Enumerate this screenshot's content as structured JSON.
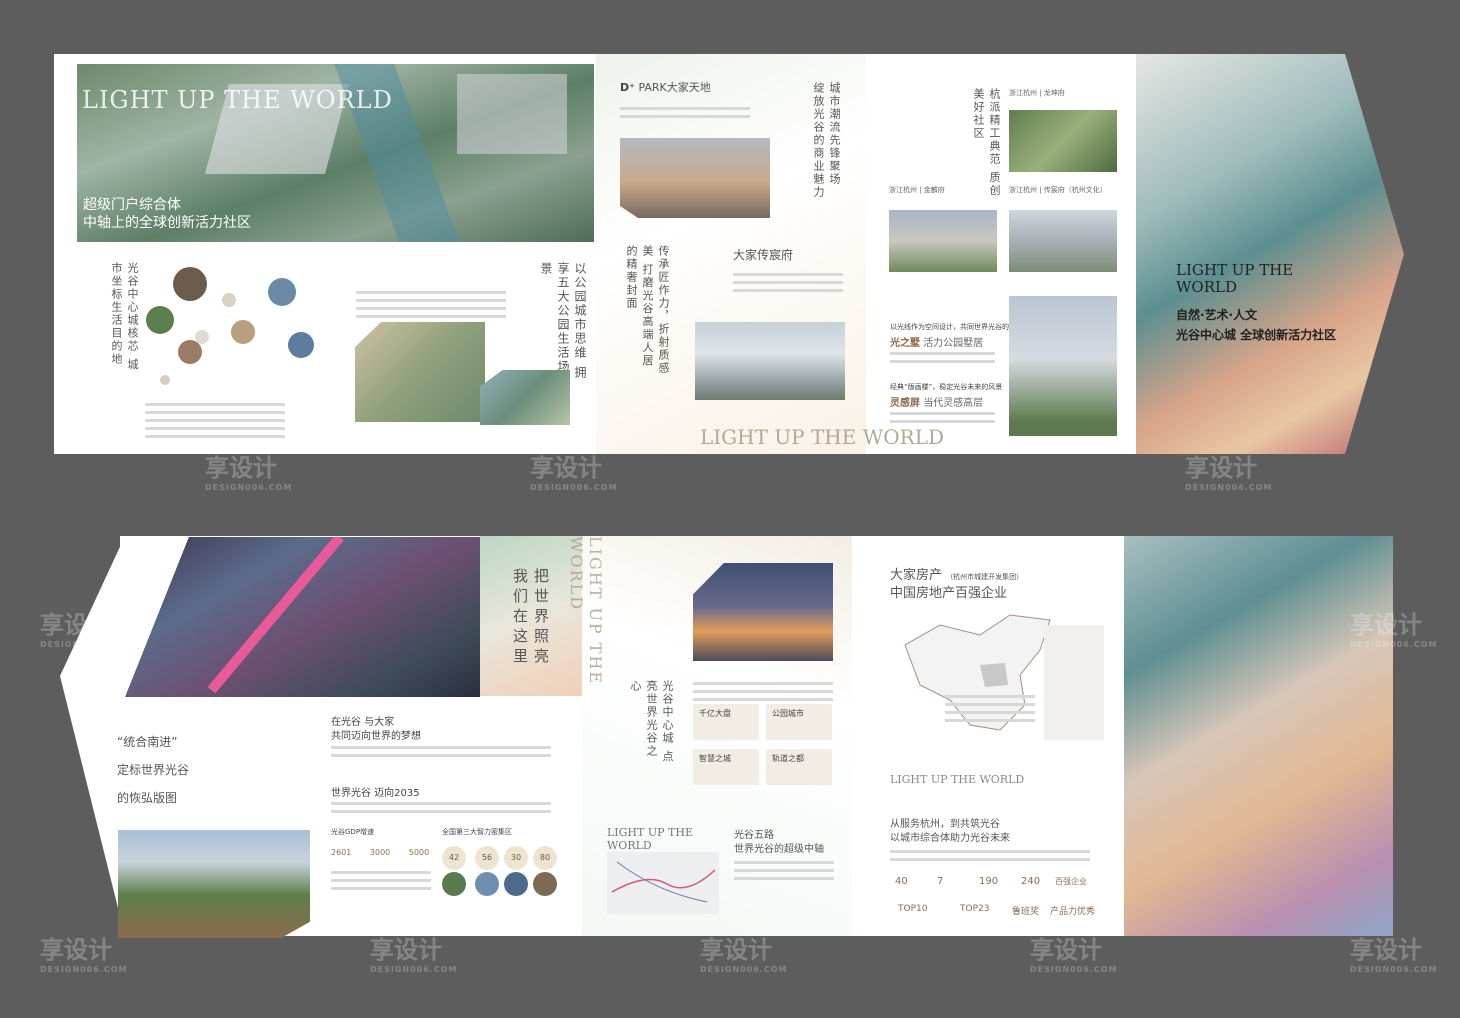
{
  "top": {
    "p1": {
      "logo": "LIGHT UP THE WORLD",
      "headline1": "超级门户综合体",
      "headline2": "中轴上的全球创新活力社区",
      "vertical_caption": "光谷中心城核芯 城市坐标生活目的地"
    },
    "p2": {
      "vertical_caption": "以公园城市思维 拥享五大公园生活场景"
    },
    "p3": {
      "brand": "PARK大家天地",
      "vertical_caption_a": "城市潮流先锋聚场 绽放光谷的商业魅力",
      "vertical_caption_b": "传承匠作力，折射质感美 打磨光谷高端人居的精奢封面",
      "sub_brand": "大家传宸府",
      "logo": "LIGHT UP THE WORLD"
    },
    "p4": {
      "vertical_caption": "杭派精工典范 质创美好社区",
      "label1": "浙江杭州 | 龙坤府",
      "label2": "浙江杭州 | 金麟府",
      "label3": "浙江杭州 | 传宸府（杭州文化）",
      "quote1": "以光线作为空间设计，共同世界光谷的灵感",
      "title1_a": "光之墅",
      "title1_b": "活力公园墅居",
      "quote2": "经典“版画楼”，稳定光谷未来的风景",
      "title2_a": "灵感屏",
      "title2_b": "当代灵感高层"
    },
    "cover": {
      "logo": "LIGHT UP THE WORLD",
      "line1": "自然·艺术·人文",
      "line2": "光谷中心城 全球创新活力社区"
    }
  },
  "bottom": {
    "p1": {
      "line1": "“统合南进”",
      "line2": "定标世界光谷",
      "line3": "的恢弘版图"
    },
    "p2": {
      "vertical_caption": "把世界照亮 我们在这里",
      "logo": "LIGHT UP THE WORLD",
      "title1a": "在光谷 与大家",
      "title1b": "共同迈向世界的梦想",
      "title2": "世界光谷 迈向2035",
      "sub1": "光谷GDP增速",
      "sub2": "全国第三大智力密集区",
      "stats": [
        "2601",
        "3000",
        "5000"
      ],
      "pcts": [
        "42",
        "56",
        "30",
        "80"
      ]
    },
    "p3": {
      "vertical_caption": "光谷中心城 点亮世界光谷之心",
      "cards": [
        "千亿大盘",
        "公园城市",
        "智慧之城",
        "轨道之都"
      ],
      "logo": "LIGHT UP THE WORLD",
      "title_a": "光谷五路",
      "title_b": "世界光谷的超级中轴"
    },
    "p4": {
      "title1": "大家房产",
      "title1_small": "（杭州市城建开发集团）",
      "title2": "中国房地产百强企业",
      "logo": "LIGHT UP THE WORLD",
      "title3": "从服务杭州，到共筑光谷",
      "title4": "以城市综合体助力光谷未来",
      "stats": [
        "40",
        "7",
        "190",
        "240"
      ],
      "stat_labels": [
        "百强企业"
      ],
      "ranks": [
        "TOP10",
        "TOP23",
        "鲁班奖",
        "产品力优秀"
      ]
    }
  },
  "watermark": {
    "main": "享设计",
    "sub": "DESIGN006.COM"
  }
}
